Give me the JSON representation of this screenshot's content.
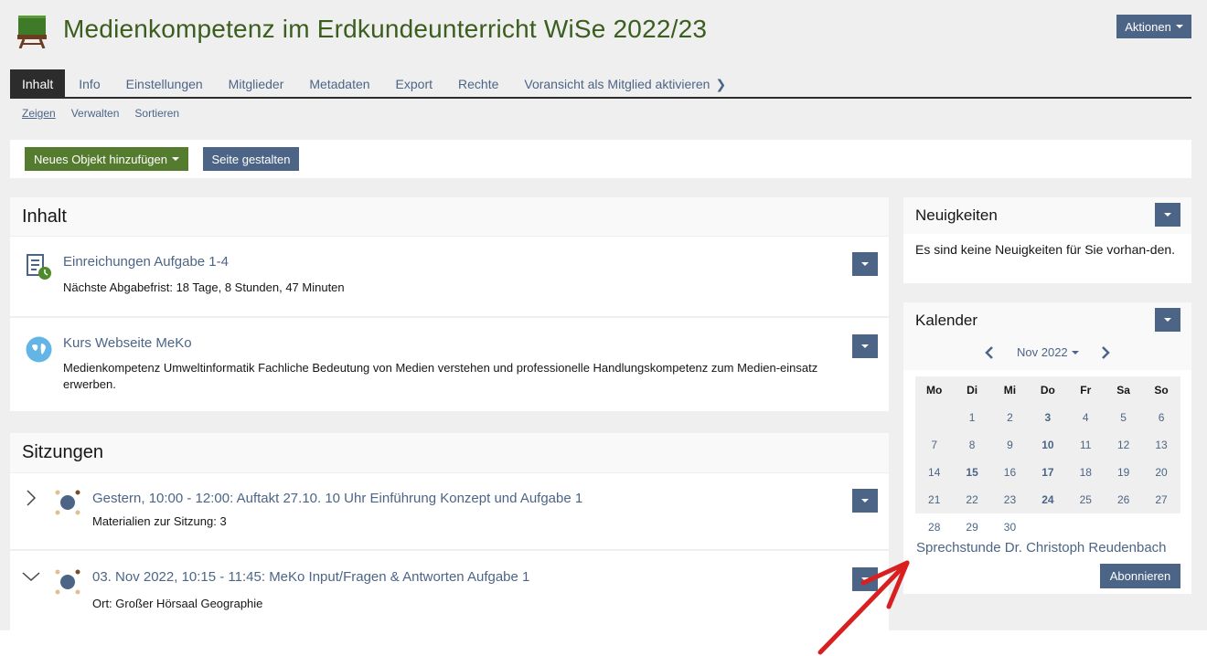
{
  "header": {
    "title": "Medienkompetenz im Erdkundeunterricht WiSe 2022/23",
    "actions_label": "Aktionen"
  },
  "tabs": [
    {
      "label": "Inhalt"
    },
    {
      "label": "Info"
    },
    {
      "label": "Einstellungen"
    },
    {
      "label": "Mitglieder"
    },
    {
      "label": "Metadaten"
    },
    {
      "label": "Export"
    },
    {
      "label": "Rechte"
    },
    {
      "label": "Voransicht als Mitglied aktivieren"
    }
  ],
  "subtabs": [
    {
      "label": "Zeigen"
    },
    {
      "label": "Verwalten"
    },
    {
      "label": "Sortieren"
    }
  ],
  "toolbar": {
    "add_label": "Neues Objekt hinzufügen",
    "design_label": "Seite gestalten"
  },
  "content_panel": {
    "title": "Inhalt",
    "items": [
      {
        "title": "Einreichungen Aufgabe 1-4",
        "sub": "Nächste Abgabefrist: 18 Tage, 8 Stunden, 47 Minuten"
      },
      {
        "title": "Kurs Webseite MeKo",
        "sub": "Medienkompetenz Umweltinformatik Fachliche Bedeutung von Medien verstehen und professionelle Handlungskompetenz zum Medien-einsatz erwerben."
      }
    ]
  },
  "sessions_panel": {
    "title": "Sitzungen",
    "items": [
      {
        "title": "Gestern, 10:00 - 12:00: Auftakt 27.10. 10 Uhr Einführung Konzept und Aufgabe 1",
        "sub": "Materialien zur Sitzung: 3"
      },
      {
        "title": "03. Nov 2022, 10:15 - 11:45: MeKo Input/Fragen & Antworten Aufgabe 1",
        "sub": "Ort: Großer Hörsaal Geographie"
      }
    ]
  },
  "news": {
    "title": "Neuigkeiten",
    "text": "Es sind keine Neuigkeiten für Sie vorhan-den."
  },
  "calendar": {
    "title": "Kalender",
    "month": "Nov 2022",
    "weekdays": [
      "Mo",
      "Di",
      "Mi",
      "Do",
      "Fr",
      "Sa",
      "So"
    ],
    "weeks": [
      [
        "",
        "1",
        "2",
        "3",
        "4",
        "5",
        "6"
      ],
      [
        "7",
        "8",
        "9",
        "10",
        "11",
        "12",
        "13"
      ],
      [
        "14",
        "15",
        "16",
        "17",
        "18",
        "19",
        "20"
      ],
      [
        "21",
        "22",
        "23",
        "24",
        "25",
        "26",
        "27"
      ],
      [
        "28",
        "29",
        "30",
        "",
        "",
        "",
        ""
      ]
    ],
    "bold_days": [
      "3",
      "10",
      "15",
      "17",
      "24"
    ],
    "link": "Sprechstunde Dr. Christoph Reudenbach",
    "subscribe_label": "Abonnieren"
  },
  "colors": {
    "accent_blue": "#4c6586",
    "title_green": "#3b5e1e",
    "button_green": "#557b2e",
    "annotation_red": "#d92020"
  }
}
